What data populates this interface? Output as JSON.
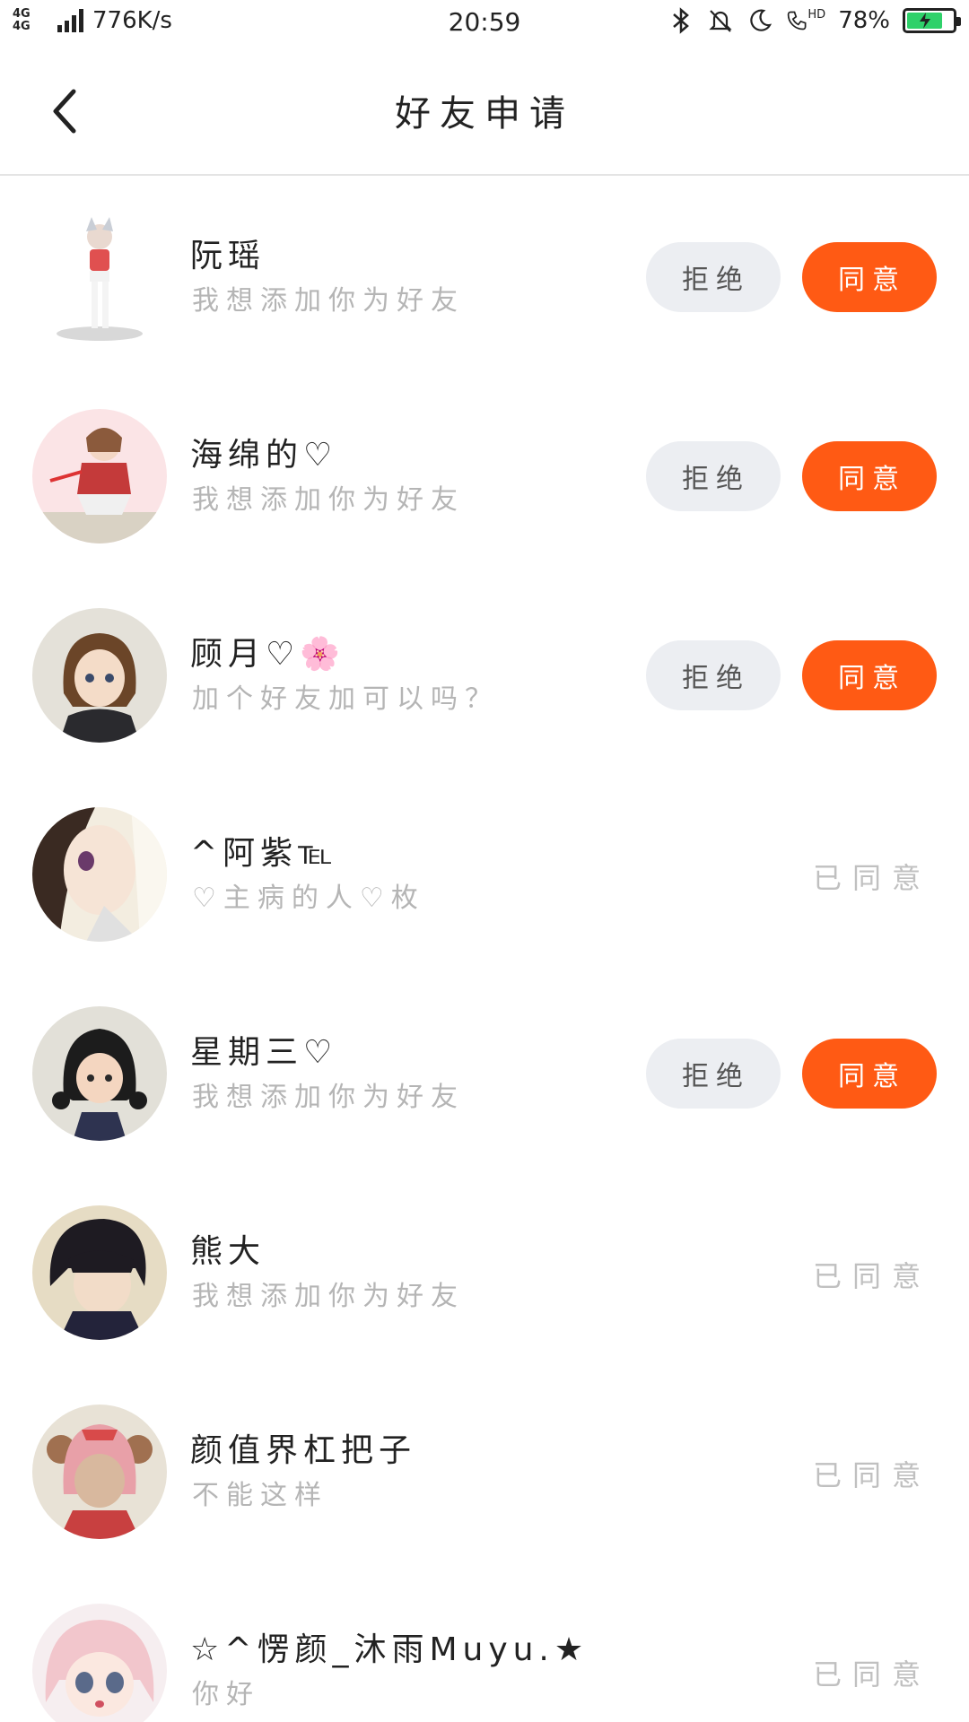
{
  "status_bar": {
    "network": "4G 4G",
    "speed": "776K/s",
    "time": "20:59",
    "battery": "78%",
    "battery_level": 0.78,
    "hd_label": "HD"
  },
  "header": {
    "title": "好友申请"
  },
  "buttons": {
    "reject": "拒绝",
    "accept": "同意",
    "agreed": "已同意"
  },
  "requests": [
    {
      "name": "阮瑶",
      "message": "我想添加你为好友",
      "status": "pending"
    },
    {
      "name": "海绵的♡",
      "message": "我想添加你为好友",
      "status": "pending"
    },
    {
      "name": "顾月♡🌸",
      "message": "加个好友加可以吗？",
      "status": "pending"
    },
    {
      "name": "^阿紫℡",
      "message": "♡主病的人♡枚",
      "status": "agreed"
    },
    {
      "name": "星期三♡",
      "message": "我想添加你为好友",
      "status": "pending"
    },
    {
      "name": "熊大",
      "message": "我想添加你为好友",
      "status": "agreed"
    },
    {
      "name": "颜值界杠把子",
      "message": "不能这样",
      "status": "agreed"
    },
    {
      "name": "☆^愣颜_沐雨Muyu.★",
      "message": "你好",
      "status": "agreed"
    }
  ],
  "colors": {
    "accent": "#ff5a14",
    "reject_bg": "#eceef2",
    "muted_text": "#b5b5b5"
  }
}
